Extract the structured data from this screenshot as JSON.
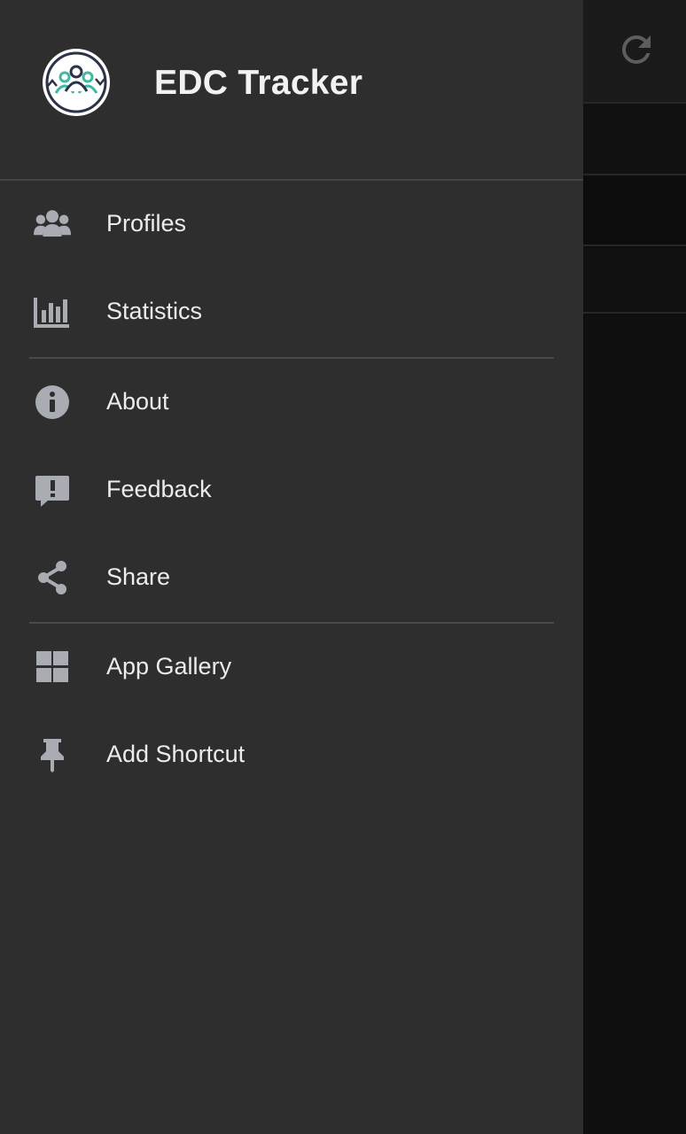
{
  "app": {
    "title": "EDC Tracker"
  },
  "colors": {
    "drawer_bg": "#2e2e2e",
    "icon": "#a9adb3",
    "text": "#ececec"
  },
  "menu": {
    "group1": [
      {
        "label": "Profiles",
        "icon": "people-icon"
      },
      {
        "label": "Statistics",
        "icon": "bar-chart-icon"
      }
    ],
    "group2": [
      {
        "label": "About",
        "icon": "info-icon"
      },
      {
        "label": "Feedback",
        "icon": "feedback-icon"
      },
      {
        "label": "Share",
        "icon": "share-icon"
      }
    ],
    "group3": [
      {
        "label": "App Gallery",
        "icon": "grid-icon"
      },
      {
        "label": "Add Shortcut",
        "icon": "pin-icon"
      }
    ]
  },
  "background": {
    "appbar_action_icon": "refresh-icon"
  }
}
